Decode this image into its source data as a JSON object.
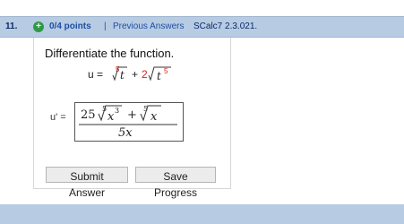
{
  "question": {
    "number": "11.",
    "points": "0/4 points",
    "separator": "|",
    "previous_answers": "Previous Answers",
    "source": "SCalc7 2.3.021."
  },
  "prompt": "Differentiate the function.",
  "function": {
    "lhs": "u =",
    "root1_index": "5",
    "root1_radicand": "t",
    "plus": "+",
    "coef": "2",
    "root2_radicand_base": "t",
    "root2_radicand_exp": "5"
  },
  "answer": {
    "label": "u' =",
    "numerator": {
      "coef": "25",
      "root1_index": "5",
      "root1_radicand_base": "x",
      "root1_radicand_exp": "3",
      "plus": "+",
      "root2_index": "5",
      "root2_radicand": "x"
    },
    "denominator": "5x"
  },
  "buttons": {
    "submit": "Submit Answer",
    "save": "Save Progress"
  },
  "colors": {
    "header_bg": "#b7cce3",
    "link": "#1f4ea3",
    "correct_green": "#2e9a45",
    "red_marked": "#d21f1f"
  }
}
